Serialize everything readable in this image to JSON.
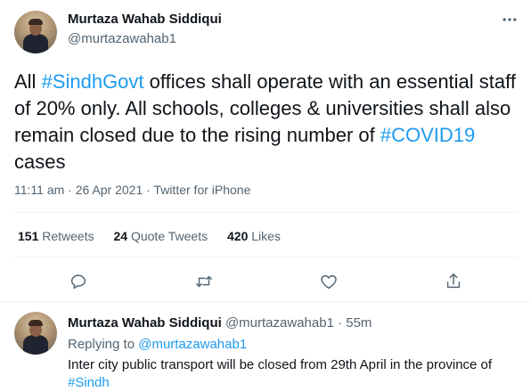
{
  "tweet": {
    "author_name": "Murtaza Wahab Siddiqui",
    "author_handle": "@murtazawahab1",
    "text_parts": {
      "p1": "All ",
      "tag1": "#SindhGovt",
      "p2": " offices shall operate with an essential staff of 20% only. All schools, colleges & universities shall also remain closed due to the rising number of ",
      "tag2": "#COVID19",
      "p3": " cases"
    },
    "meta": "11:11 am · 26 Apr 2021 · Twitter for iPhone",
    "stats": {
      "retweets_count": "151",
      "retweets_label": "Retweets",
      "quotes_count": "24",
      "quotes_label": "Quote Tweets",
      "likes_count": "420",
      "likes_label": "Likes"
    },
    "actions": [
      "reply-icon",
      "retweet-icon",
      "like-icon",
      "share-icon"
    ],
    "more_icon": "more-horizontal-icon"
  },
  "reply": {
    "author_name": "Murtaza Wahab Siddiqui",
    "author_handle_time": "@murtazawahab1 · 55m",
    "replying_prefix": "Replying to ",
    "replying_mention": "@murtazawahab1",
    "text": "Inter city public transport will be closed from 29th April in the province of ",
    "tag": "#Sindh"
  },
  "colors": {
    "accent": "#1d9bf0",
    "text_primary": "#0f1419",
    "text_secondary": "#536471",
    "divider": "#eff3f4"
  }
}
